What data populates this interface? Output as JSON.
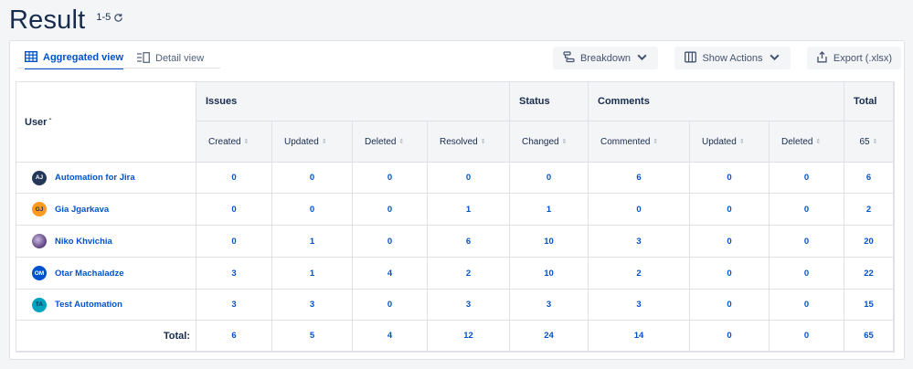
{
  "header": {
    "title": "Result",
    "range": "1-5"
  },
  "tabs": [
    {
      "label": "Aggregated view",
      "active": true
    },
    {
      "label": "Detail view",
      "active": false
    }
  ],
  "toolbar": {
    "breakdown": "Breakdown",
    "show_actions": "Show Actions",
    "export": "Export (.xlsx)"
  },
  "table": {
    "user_header": "User",
    "groups": {
      "issues": "Issues",
      "status": "Status",
      "comments": "Comments",
      "total": "Total"
    },
    "columns": [
      "Created",
      "Updated",
      "Deleted",
      "Resolved",
      "Changed",
      "Commented",
      "Updated",
      "Deleted"
    ],
    "total_header_value": "65",
    "rows": [
      {
        "initials": "AJ",
        "avatar_color": "#253858",
        "name": "Automation for Jira",
        "values": [
          "0",
          "0",
          "0",
          "0",
          "0",
          "6",
          "0",
          "0"
        ],
        "total": "6"
      },
      {
        "initials": "GJ",
        "avatar_color": "#ff991f",
        "name": "Gia Jgarkava",
        "values": [
          "0",
          "0",
          "0",
          "1",
          "1",
          "0",
          "0",
          "0"
        ],
        "total": "2"
      },
      {
        "initials": "",
        "avatar_color": "#6b4f8c",
        "name": "Niko Khvichia",
        "values": [
          "0",
          "1",
          "0",
          "6",
          "10",
          "3",
          "0",
          "0"
        ],
        "total": "20"
      },
      {
        "initials": "OM",
        "avatar_color": "#0052cc",
        "name": "Otar Machaladze",
        "values": [
          "3",
          "1",
          "4",
          "2",
          "10",
          "2",
          "0",
          "0"
        ],
        "total": "22"
      },
      {
        "initials": "TA",
        "avatar_color": "#00a3bf",
        "name": "Test Automation",
        "values": [
          "3",
          "3",
          "0",
          "3",
          "3",
          "3",
          "0",
          "0"
        ],
        "total": "15"
      }
    ],
    "totals_label": "Total:",
    "totals": [
      "6",
      "5",
      "4",
      "12",
      "24",
      "14",
      "0",
      "0"
    ],
    "grand_total": "65"
  },
  "colors": {
    "accent": "#0052cc",
    "text": "#172b4d",
    "header_bg": "#f4f5f7"
  },
  "icons": [
    "refresh-icon",
    "table-grid-icon",
    "detail-list-icon",
    "breakdown-icon",
    "columns-icon",
    "export-icon",
    "chevron-down-icon",
    "sort-icon"
  ]
}
